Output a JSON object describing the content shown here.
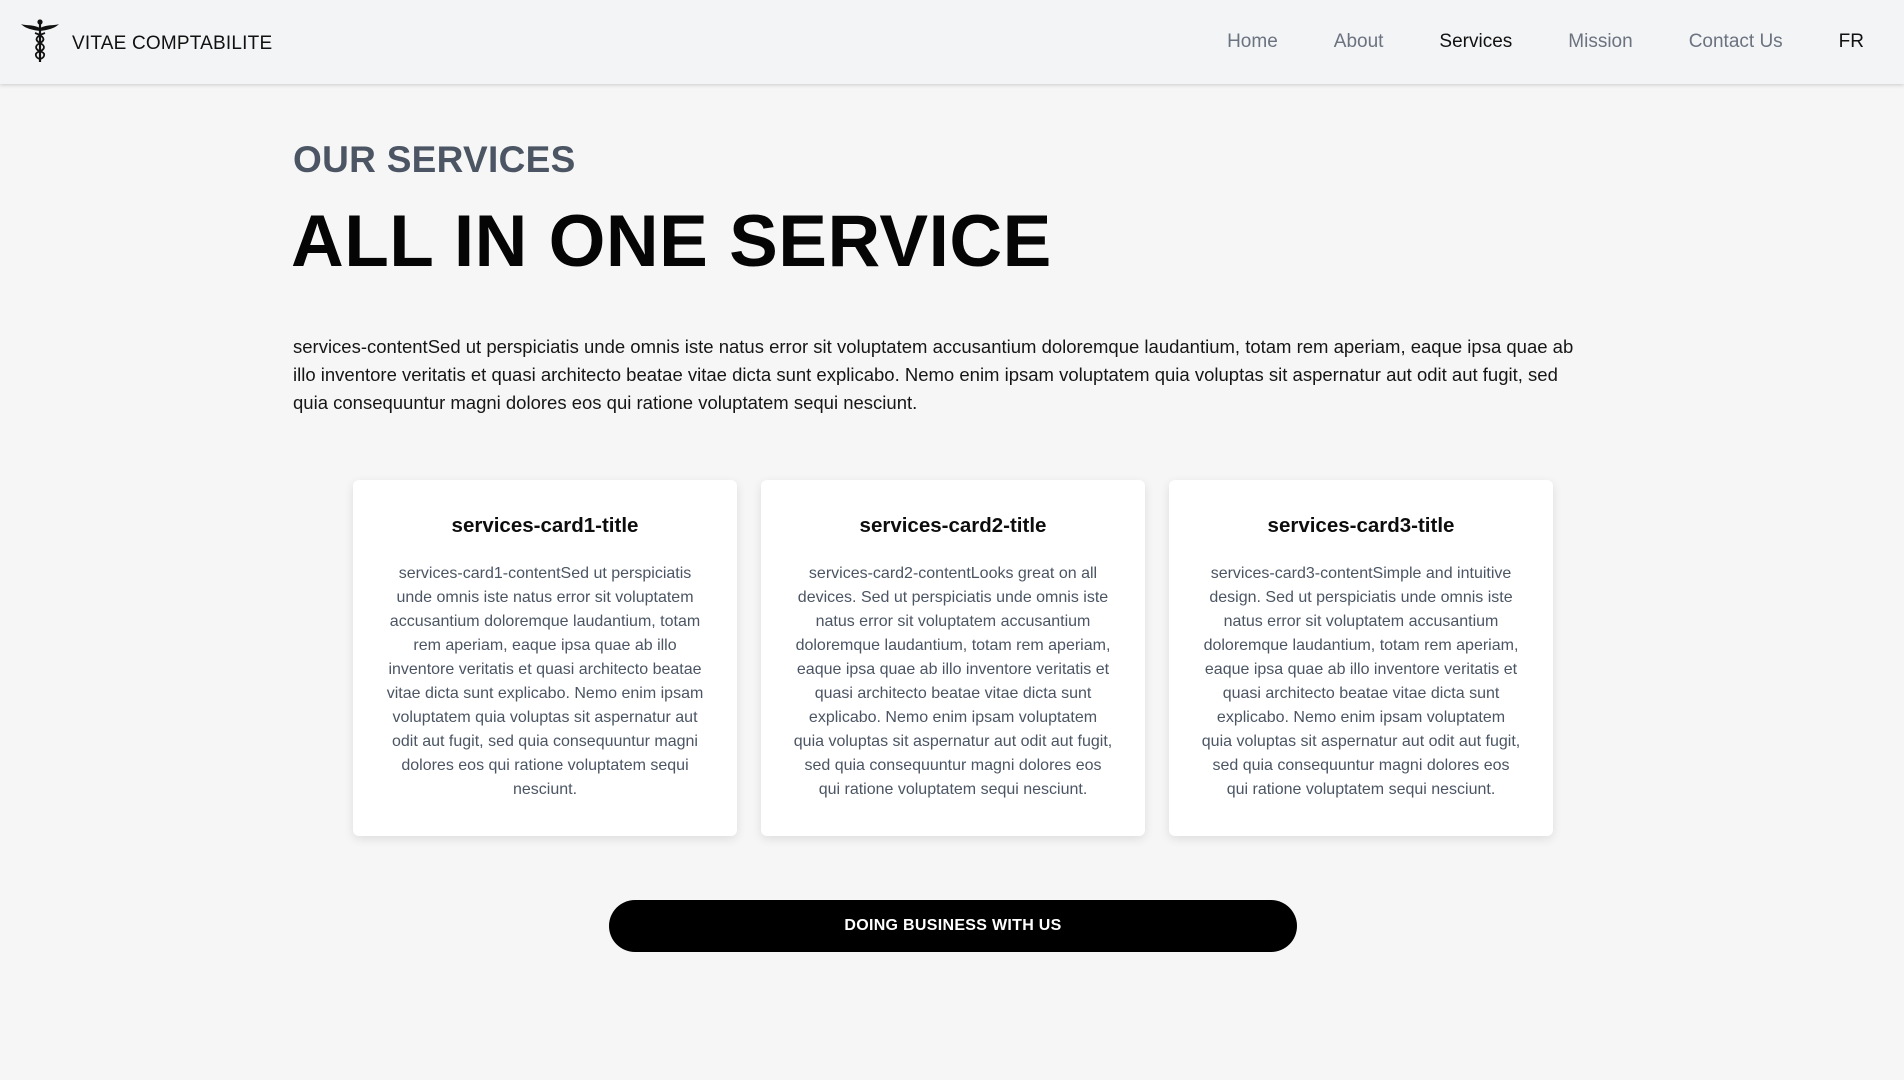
{
  "brand": {
    "name": "VITAE COMPTABILITE",
    "logo_icon": "caduceus-icon"
  },
  "nav": {
    "items": [
      {
        "label": "Home"
      },
      {
        "label": "About"
      },
      {
        "label": "Services"
      },
      {
        "label": "Mission"
      },
      {
        "label": "Contact Us"
      }
    ],
    "active": "Services",
    "lang": "FR"
  },
  "services": {
    "label": "OUR SERVICES",
    "title": "ALL IN ONE SERVICE",
    "intro": "services-contentSed ut perspiciatis unde omnis iste natus error sit voluptatem accusantium doloremque laudantium, totam rem aperiam, eaque ipsa quae ab illo inventore veritatis et quasi architecto beatae vitae dicta sunt explicabo. Nemo enim ipsam voluptatem quia voluptas sit aspernatur aut odit aut fugit, sed quia consequuntur magni dolores eos qui ratione voluptatem sequi nesciunt.",
    "cards": [
      {
        "title": "services-card1-title",
        "content": "services-card1-contentSed ut perspiciatis unde omnis iste natus error sit voluptatem accusantium doloremque laudantium, totam rem aperiam, eaque ipsa quae ab illo inventore veritatis et quasi architecto beatae vitae dicta sunt explicabo. Nemo enim ipsam voluptatem quia voluptas sit aspernatur aut odit aut fugit, sed quia consequuntur magni dolores eos qui ratione voluptatem sequi nesciunt."
      },
      {
        "title": "services-card2-title",
        "content": "services-card2-contentLooks great on all devices. Sed ut perspiciatis unde omnis iste natus error sit voluptatem accusantium doloremque laudantium, totam rem aperiam, eaque ipsa quae ab illo inventore veritatis et quasi architecto beatae vitae dicta sunt explicabo. Nemo enim ipsam voluptatem quia voluptas sit aspernatur aut odit aut fugit, sed quia consequuntur magni dolores eos qui ratione voluptatem sequi nesciunt."
      },
      {
        "title": "services-card3-title",
        "content": "services-card3-contentSimple and intuitive design. Sed ut perspiciatis unde omnis iste natus error sit voluptatem accusantium doloremque laudantium, totam rem aperiam, eaque ipsa quae ab illo inventore veritatis et quasi architecto beatae vitae dicta sunt explicabo. Nemo enim ipsam voluptatem quia voluptas sit aspernatur aut odit aut fugit, sed quia consequuntur magni dolores eos qui ratione voluptatem sequi nesciunt."
      }
    ],
    "cta_label": "DOING BUSINESS WITH US"
  },
  "colors": {
    "page_bg": "#f6f6f6",
    "navbar_bg": "#f3f4f5",
    "nav_inactive": "#6b7280",
    "label_gray": "#4b5563",
    "cta_bg": "#000000"
  }
}
